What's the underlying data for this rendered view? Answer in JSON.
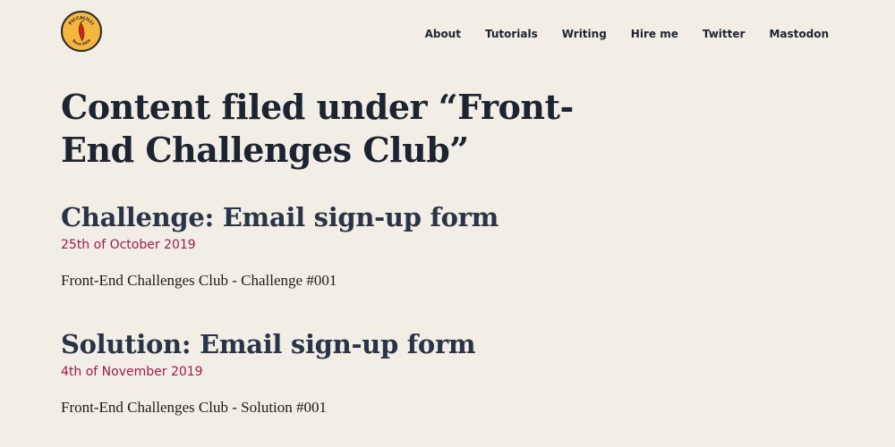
{
  "site": {
    "logo_text_top": "PICCALILLI",
    "logo_text_bottom": "Since 2019",
    "brand_color": "#f4b63f"
  },
  "nav": {
    "items": [
      "About",
      "Tutorials",
      "Writing",
      "Hire me",
      "Twitter",
      "Mastodon"
    ]
  },
  "page": {
    "title": "Content filed under “Front-End Challenges Club”"
  },
  "entries": [
    {
      "title": "Challenge: Email sign-up form",
      "date": "25th of October 2019",
      "summary": "Front-End Challenges Club - Challenge #001"
    },
    {
      "title": "Solution: Email sign-up form",
      "date": "4th of November 2019",
      "summary": "Front-End Challenges Club - Solution #001"
    }
  ],
  "colors": {
    "background": "#f3eee5",
    "heading": "#1c2432",
    "date": "#a41a4a"
  }
}
